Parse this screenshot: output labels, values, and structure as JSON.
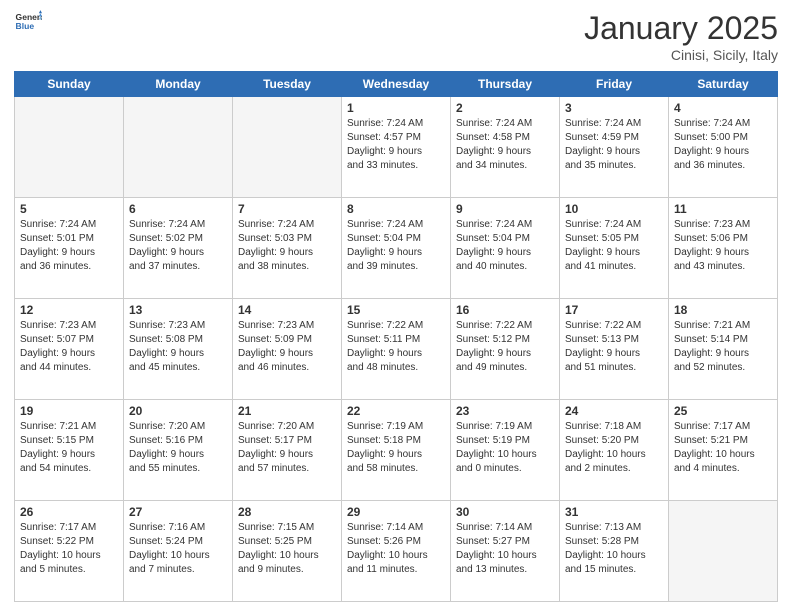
{
  "header": {
    "logo_general": "General",
    "logo_blue": "Blue",
    "month": "January 2025",
    "location": "Cinisi, Sicily, Italy"
  },
  "weekdays": [
    "Sunday",
    "Monday",
    "Tuesday",
    "Wednesday",
    "Thursday",
    "Friday",
    "Saturday"
  ],
  "weeks": [
    [
      {
        "day": "",
        "text": ""
      },
      {
        "day": "",
        "text": ""
      },
      {
        "day": "",
        "text": ""
      },
      {
        "day": "1",
        "text": "Sunrise: 7:24 AM\nSunset: 4:57 PM\nDaylight: 9 hours\nand 33 minutes."
      },
      {
        "day": "2",
        "text": "Sunrise: 7:24 AM\nSunset: 4:58 PM\nDaylight: 9 hours\nand 34 minutes."
      },
      {
        "day": "3",
        "text": "Sunrise: 7:24 AM\nSunset: 4:59 PM\nDaylight: 9 hours\nand 35 minutes."
      },
      {
        "day": "4",
        "text": "Sunrise: 7:24 AM\nSunset: 5:00 PM\nDaylight: 9 hours\nand 36 minutes."
      }
    ],
    [
      {
        "day": "5",
        "text": "Sunrise: 7:24 AM\nSunset: 5:01 PM\nDaylight: 9 hours\nand 36 minutes."
      },
      {
        "day": "6",
        "text": "Sunrise: 7:24 AM\nSunset: 5:02 PM\nDaylight: 9 hours\nand 37 minutes."
      },
      {
        "day": "7",
        "text": "Sunrise: 7:24 AM\nSunset: 5:03 PM\nDaylight: 9 hours\nand 38 minutes."
      },
      {
        "day": "8",
        "text": "Sunrise: 7:24 AM\nSunset: 5:04 PM\nDaylight: 9 hours\nand 39 minutes."
      },
      {
        "day": "9",
        "text": "Sunrise: 7:24 AM\nSunset: 5:04 PM\nDaylight: 9 hours\nand 40 minutes."
      },
      {
        "day": "10",
        "text": "Sunrise: 7:24 AM\nSunset: 5:05 PM\nDaylight: 9 hours\nand 41 minutes."
      },
      {
        "day": "11",
        "text": "Sunrise: 7:23 AM\nSunset: 5:06 PM\nDaylight: 9 hours\nand 43 minutes."
      }
    ],
    [
      {
        "day": "12",
        "text": "Sunrise: 7:23 AM\nSunset: 5:07 PM\nDaylight: 9 hours\nand 44 minutes."
      },
      {
        "day": "13",
        "text": "Sunrise: 7:23 AM\nSunset: 5:08 PM\nDaylight: 9 hours\nand 45 minutes."
      },
      {
        "day": "14",
        "text": "Sunrise: 7:23 AM\nSunset: 5:09 PM\nDaylight: 9 hours\nand 46 minutes."
      },
      {
        "day": "15",
        "text": "Sunrise: 7:22 AM\nSunset: 5:11 PM\nDaylight: 9 hours\nand 48 minutes."
      },
      {
        "day": "16",
        "text": "Sunrise: 7:22 AM\nSunset: 5:12 PM\nDaylight: 9 hours\nand 49 minutes."
      },
      {
        "day": "17",
        "text": "Sunrise: 7:22 AM\nSunset: 5:13 PM\nDaylight: 9 hours\nand 51 minutes."
      },
      {
        "day": "18",
        "text": "Sunrise: 7:21 AM\nSunset: 5:14 PM\nDaylight: 9 hours\nand 52 minutes."
      }
    ],
    [
      {
        "day": "19",
        "text": "Sunrise: 7:21 AM\nSunset: 5:15 PM\nDaylight: 9 hours\nand 54 minutes."
      },
      {
        "day": "20",
        "text": "Sunrise: 7:20 AM\nSunset: 5:16 PM\nDaylight: 9 hours\nand 55 minutes."
      },
      {
        "day": "21",
        "text": "Sunrise: 7:20 AM\nSunset: 5:17 PM\nDaylight: 9 hours\nand 57 minutes."
      },
      {
        "day": "22",
        "text": "Sunrise: 7:19 AM\nSunset: 5:18 PM\nDaylight: 9 hours\nand 58 minutes."
      },
      {
        "day": "23",
        "text": "Sunrise: 7:19 AM\nSunset: 5:19 PM\nDaylight: 10 hours\nand 0 minutes."
      },
      {
        "day": "24",
        "text": "Sunrise: 7:18 AM\nSunset: 5:20 PM\nDaylight: 10 hours\nand 2 minutes."
      },
      {
        "day": "25",
        "text": "Sunrise: 7:17 AM\nSunset: 5:21 PM\nDaylight: 10 hours\nand 4 minutes."
      }
    ],
    [
      {
        "day": "26",
        "text": "Sunrise: 7:17 AM\nSunset: 5:22 PM\nDaylight: 10 hours\nand 5 minutes."
      },
      {
        "day": "27",
        "text": "Sunrise: 7:16 AM\nSunset: 5:24 PM\nDaylight: 10 hours\nand 7 minutes."
      },
      {
        "day": "28",
        "text": "Sunrise: 7:15 AM\nSunset: 5:25 PM\nDaylight: 10 hours\nand 9 minutes."
      },
      {
        "day": "29",
        "text": "Sunrise: 7:14 AM\nSunset: 5:26 PM\nDaylight: 10 hours\nand 11 minutes."
      },
      {
        "day": "30",
        "text": "Sunrise: 7:14 AM\nSunset: 5:27 PM\nDaylight: 10 hours\nand 13 minutes."
      },
      {
        "day": "31",
        "text": "Sunrise: 7:13 AM\nSunset: 5:28 PM\nDaylight: 10 hours\nand 15 minutes."
      },
      {
        "day": "",
        "text": ""
      }
    ]
  ]
}
